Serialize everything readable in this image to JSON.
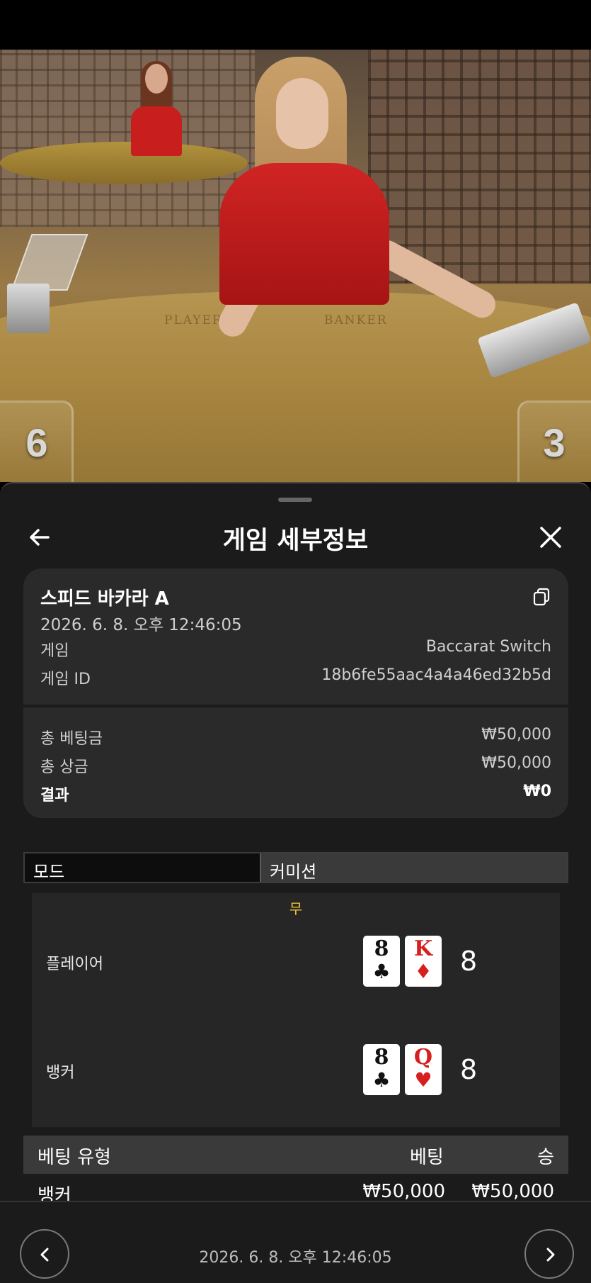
{
  "video": {
    "table_labels": [
      "PLAYER",
      "BANKER"
    ],
    "player_score": "6",
    "banker_score": "3"
  },
  "header": {
    "title": "게임 세부정보",
    "back_icon": "arrow-left-icon",
    "close_icon": "close-icon"
  },
  "summary": {
    "game_name": "스피드 바카라 A",
    "datetime": "2026. 6. 8. 오후 12:46:05",
    "rows": [
      {
        "label": "게임",
        "value": "Baccarat Switch"
      },
      {
        "label": "게임 ID",
        "value": "18b6fe55aac4a4a46ed32b5d"
      }
    ],
    "totals": [
      {
        "label": "총 베팅금",
        "value": "₩50,000"
      },
      {
        "label": "총 상금",
        "value": "₩50,000"
      },
      {
        "label": "결과",
        "value": "₩0"
      }
    ]
  },
  "tabs": {
    "mode": "모드",
    "commission": "커미션"
  },
  "result": {
    "outcome": "무",
    "player": {
      "label": "플레이어",
      "cards": [
        {
          "rank": "8",
          "suit": "♣",
          "color": "black"
        },
        {
          "rank": "K",
          "suit": "♦",
          "color": "red"
        }
      ],
      "total": "8"
    },
    "banker": {
      "label": "뱅커",
      "cards": [
        {
          "rank": "8",
          "suit": "♣",
          "color": "black"
        },
        {
          "rank": "Q",
          "suit": "♥",
          "color": "red"
        }
      ],
      "total": "8"
    }
  },
  "bets": {
    "columns": [
      "베팅 유형",
      "베팅",
      "승"
    ],
    "rows": [
      {
        "type": "뱅커",
        "bet": "₩50,000",
        "win": "₩50,000"
      }
    ]
  },
  "footer": {
    "datetime": "2026. 6. 8. 오후 12:46:05"
  },
  "colors": {
    "sheet_bg": "#1b1b1b",
    "card_bg": "#2a2a2a",
    "tie_accent": "#f1c232",
    "card_red": "#d62020"
  }
}
